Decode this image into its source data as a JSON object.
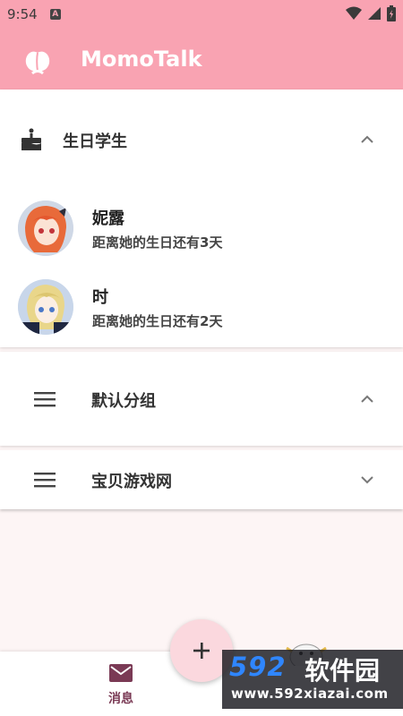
{
  "status_bar": {
    "time": "9:54",
    "badge": "A"
  },
  "app": {
    "title": "MomoTalk"
  },
  "birthday_group": {
    "title": "生日学生",
    "students": [
      {
        "name": "妮露",
        "desc": "距离她的生日还有3天"
      },
      {
        "name": "时",
        "desc": "距离她的生日还有2天"
      }
    ]
  },
  "groups": [
    {
      "title": "默认分组",
      "expanded": true
    },
    {
      "title": "宝贝游戏网",
      "expanded": false
    }
  ],
  "bottom_nav": {
    "messages_label": "消息"
  },
  "fab": {
    "label": "+"
  },
  "watermark": {
    "brand": "592",
    "name": "软件园",
    "url": "www.592xiazai.com"
  },
  "colors": {
    "accent": "#f9a3b2",
    "nav_active": "#7a3a55",
    "fab": "#fbd8de"
  }
}
